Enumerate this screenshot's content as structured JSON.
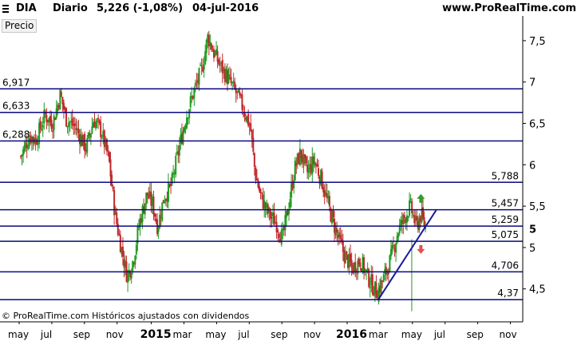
{
  "header": {
    "ticker": "DIA",
    "period": "Diario",
    "quote": "5,226 (-1,08%)",
    "date": "04-jul-2016",
    "site": "www.ProRealTime.com"
  },
  "panel_label": "Precio",
  "copyright": "© ProRealTime.com Históricos ajustados con dividendos",
  "colors": {
    "up": "#1f9a1f",
    "down": "#c0282a",
    "level_line": "#0a0a80",
    "trend_line": "#1a1a9a",
    "arrow_up": "#2aa02a",
    "arrow_down": "#e05050"
  },
  "chart_data": {
    "type": "candlestick",
    "ylim": [
      4.15,
      7.75
    ],
    "y_ticks": [
      4.5,
      5,
      5.5,
      6,
      6.5,
      7,
      7.5
    ],
    "y_tick_labels": [
      "4,5",
      "5",
      "5,5",
      "6",
      "6,5",
      "7",
      "7,5"
    ],
    "last_price": 5.226,
    "x_labels": [
      "may",
      "jul",
      "sep",
      "nov",
      "2015",
      "mar",
      "may",
      "jul",
      "sep",
      "nov",
      "2016",
      "mar",
      "may",
      "jul",
      "sep",
      "nov"
    ],
    "x_labels_bold": [
      "2015",
      "2016"
    ],
    "x_domain": [
      0,
      26.7
    ],
    "x_label_positions": [
      0.7,
      2.7,
      4.8,
      6.8,
      8.4,
      10.5,
      12.5,
      14.5,
      16.6,
      18.6,
      20.2,
      22.3,
      24.4,
      26.4,
      28.4,
      30.5
    ],
    "horizontal_levels": [
      {
        "value": 6.917,
        "label": "6,917",
        "label_side": "left"
      },
      {
        "value": 6.633,
        "label": "6,633",
        "label_side": "left"
      },
      {
        "value": 6.288,
        "label": "6,288",
        "label_side": "left"
      },
      {
        "value": 5.788,
        "label": "5,788",
        "label_side": "right"
      },
      {
        "value": 5.457,
        "label": "5,457",
        "label_side": "right"
      },
      {
        "value": 5.259,
        "label": "5,259",
        "label_side": "right"
      },
      {
        "value": 5.075,
        "label": "5,075",
        "label_side": "right"
      },
      {
        "value": 4.706,
        "label": "4,706",
        "label_side": "right"
      },
      {
        "value": 4.37,
        "label": "4,37",
        "label_side": "right"
      }
    ],
    "trendline": {
      "x": [
        23.5,
        27.3
      ],
      "y": [
        4.37,
        5.45
      ]
    },
    "price_path": [
      [
        0,
        6.1
      ],
      [
        0.6,
        6.35
      ],
      [
        1.0,
        6.3
      ],
      [
        1.6,
        6.6
      ],
      [
        2.1,
        6.5
      ],
      [
        2.6,
        6.85
      ],
      [
        3.0,
        6.55
      ],
      [
        3.6,
        6.45
      ],
      [
        4.3,
        6.2
      ],
      [
        4.8,
        6.55
      ],
      [
        5.3,
        6.4
      ],
      [
        5.8,
        6.05
      ],
      [
        6.2,
        5.4
      ],
      [
        6.6,
        5.0
      ],
      [
        7.0,
        4.65
      ],
      [
        7.4,
        4.85
      ],
      [
        7.8,
        5.3
      ],
      [
        8.3,
        5.65
      ],
      [
        8.7,
        5.5
      ],
      [
        9.0,
        5.25
      ],
      [
        9.4,
        5.6
      ],
      [
        9.9,
        5.75
      ],
      [
        10.4,
        6.2
      ],
      [
        10.9,
        6.6
      ],
      [
        11.4,
        6.9
      ],
      [
        11.9,
        7.15
      ],
      [
        12.3,
        7.55
      ],
      [
        12.7,
        7.35
      ],
      [
        13.1,
        7.2
      ],
      [
        13.6,
        7.05
      ],
      [
        14.2,
        6.85
      ],
      [
        14.7,
        6.65
      ],
      [
        15.1,
        6.45
      ],
      [
        15.4,
        5.9
      ],
      [
        15.8,
        5.6
      ],
      [
        16.3,
        5.4
      ],
      [
        16.8,
        5.3
      ],
      [
        17.2,
        5.1
      ],
      [
        17.6,
        5.5
      ],
      [
        18.0,
        5.95
      ],
      [
        18.4,
        6.15
      ],
      [
        18.8,
        5.9
      ],
      [
        19.3,
        6.05
      ],
      [
        19.8,
        5.8
      ],
      [
        20.3,
        5.45
      ],
      [
        20.8,
        5.15
      ],
      [
        21.3,
        4.9
      ],
      [
        21.8,
        4.75
      ],
      [
        22.3,
        4.85
      ],
      [
        22.8,
        4.65
      ],
      [
        23.4,
        4.45
      ],
      [
        23.8,
        4.6
      ],
      [
        24.3,
        4.85
      ],
      [
        24.8,
        5.2
      ],
      [
        25.2,
        5.35
      ],
      [
        25.6,
        5.5
      ],
      [
        26.0,
        5.25
      ],
      [
        26.3,
        5.4
      ],
      [
        26.6,
        5.23
      ]
    ]
  }
}
